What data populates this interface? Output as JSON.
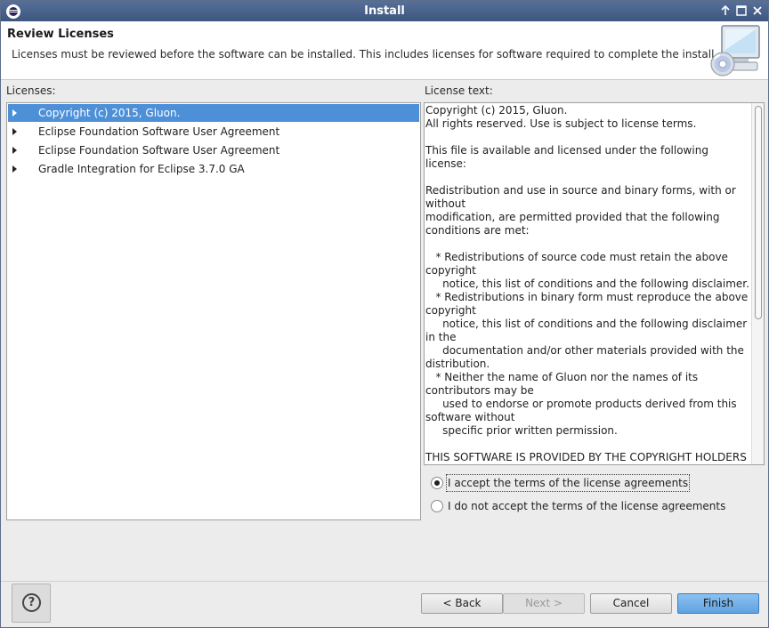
{
  "window": {
    "title": "Install"
  },
  "header": {
    "title": "Review Licenses",
    "description": "Licenses must be reviewed before the software can be installed.  This includes licenses for software required to complete the install."
  },
  "licenses": {
    "label": "Licenses:",
    "items": [
      {
        "label": "Copyright (c) 2015, Gluon.",
        "selected": true
      },
      {
        "label": "Eclipse Foundation Software User Agreement",
        "selected": false
      },
      {
        "label": "Eclipse Foundation Software User Agreement",
        "selected": false
      },
      {
        "label": "Gradle Integration for Eclipse 3.7.0 GA",
        "selected": false
      }
    ]
  },
  "license_text": {
    "label": "License text:",
    "content": "Copyright (c) 2015, Gluon.\nAll rights reserved. Use is subject to license terms.\n\nThis file is available and licensed under the following license:\n\nRedistribution and use in source and binary forms, with or without\nmodification, are permitted provided that the following conditions are met:\n\n   * Redistributions of source code must retain the above copyright\n     notice, this list of conditions and the following disclaimer.\n   * Redistributions in binary form must reproduce the above copyright\n     notice, this list of conditions and the following disclaimer in the\n     documentation and/or other materials provided with the distribution.\n   * Neither the name of Gluon nor the names of its contributors may be\n     used to endorse or promote products derived from this software without\n     specific prior written permission.\n\nTHIS SOFTWARE IS PROVIDED BY THE COPYRIGHT HOLDERS AND CONTRIBUTORS \"AS IS\" AND"
  },
  "options": {
    "accept": "I accept the terms of the license agreements",
    "decline": "I do not accept the terms of the license agreements",
    "selected": "accept"
  },
  "buttons": {
    "help": "?",
    "back": "< Back",
    "next": "Next >",
    "cancel": "Cancel",
    "finish": "Finish"
  },
  "colors": {
    "selection": "#4e90d8",
    "titlebar": "#3d567e",
    "default_button": "#5fa2e0"
  },
  "icons": {
    "app": "eclipse-icon",
    "wizard": "computer-cd-icon",
    "help": "help-icon",
    "expand": "expand-arrow-icon"
  }
}
